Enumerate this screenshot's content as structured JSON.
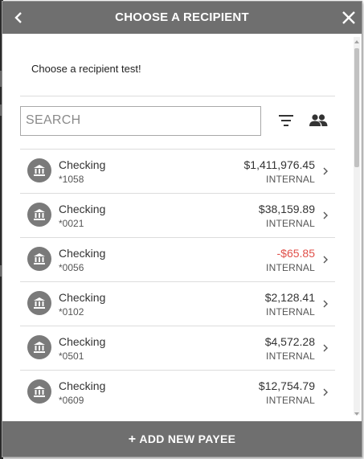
{
  "header": {
    "title": "CHOOSE A RECIPIENT",
    "back_icon": "chevron-left-icon",
    "close_icon": "close-icon"
  },
  "subtitle": "Choose a recipient test!",
  "search": {
    "placeholder": "SEARCH",
    "value": ""
  },
  "toolbar": {
    "filter_icon": "filter-icon",
    "contacts_icon": "people-icon"
  },
  "recipients": [
    {
      "name": "Checking",
      "account": "*1058",
      "amount": "$1,411,976.45",
      "type": "INTERNAL",
      "negative": false
    },
    {
      "name": "Checking",
      "account": "*0021",
      "amount": "$38,159.89",
      "type": "INTERNAL",
      "negative": false
    },
    {
      "name": "Checking",
      "account": "*0056",
      "amount": "-$65.85",
      "type": "INTERNAL",
      "negative": true
    },
    {
      "name": "Checking",
      "account": "*0102",
      "amount": "$2,128.41",
      "type": "INTERNAL",
      "negative": false
    },
    {
      "name": "Checking",
      "account": "*0501",
      "amount": "$4,572.28",
      "type": "INTERNAL",
      "negative": false
    },
    {
      "name": "Checking",
      "account": "*0609",
      "amount": "$12,754.79",
      "type": "INTERNAL",
      "negative": false
    }
  ],
  "footer": {
    "plus": "+",
    "label": "ADD NEW PAYEE"
  },
  "colors": {
    "header_bg": "#6f6f6f",
    "negative_amount": "#e0504a",
    "avatar_bg": "#7a7a7a"
  }
}
